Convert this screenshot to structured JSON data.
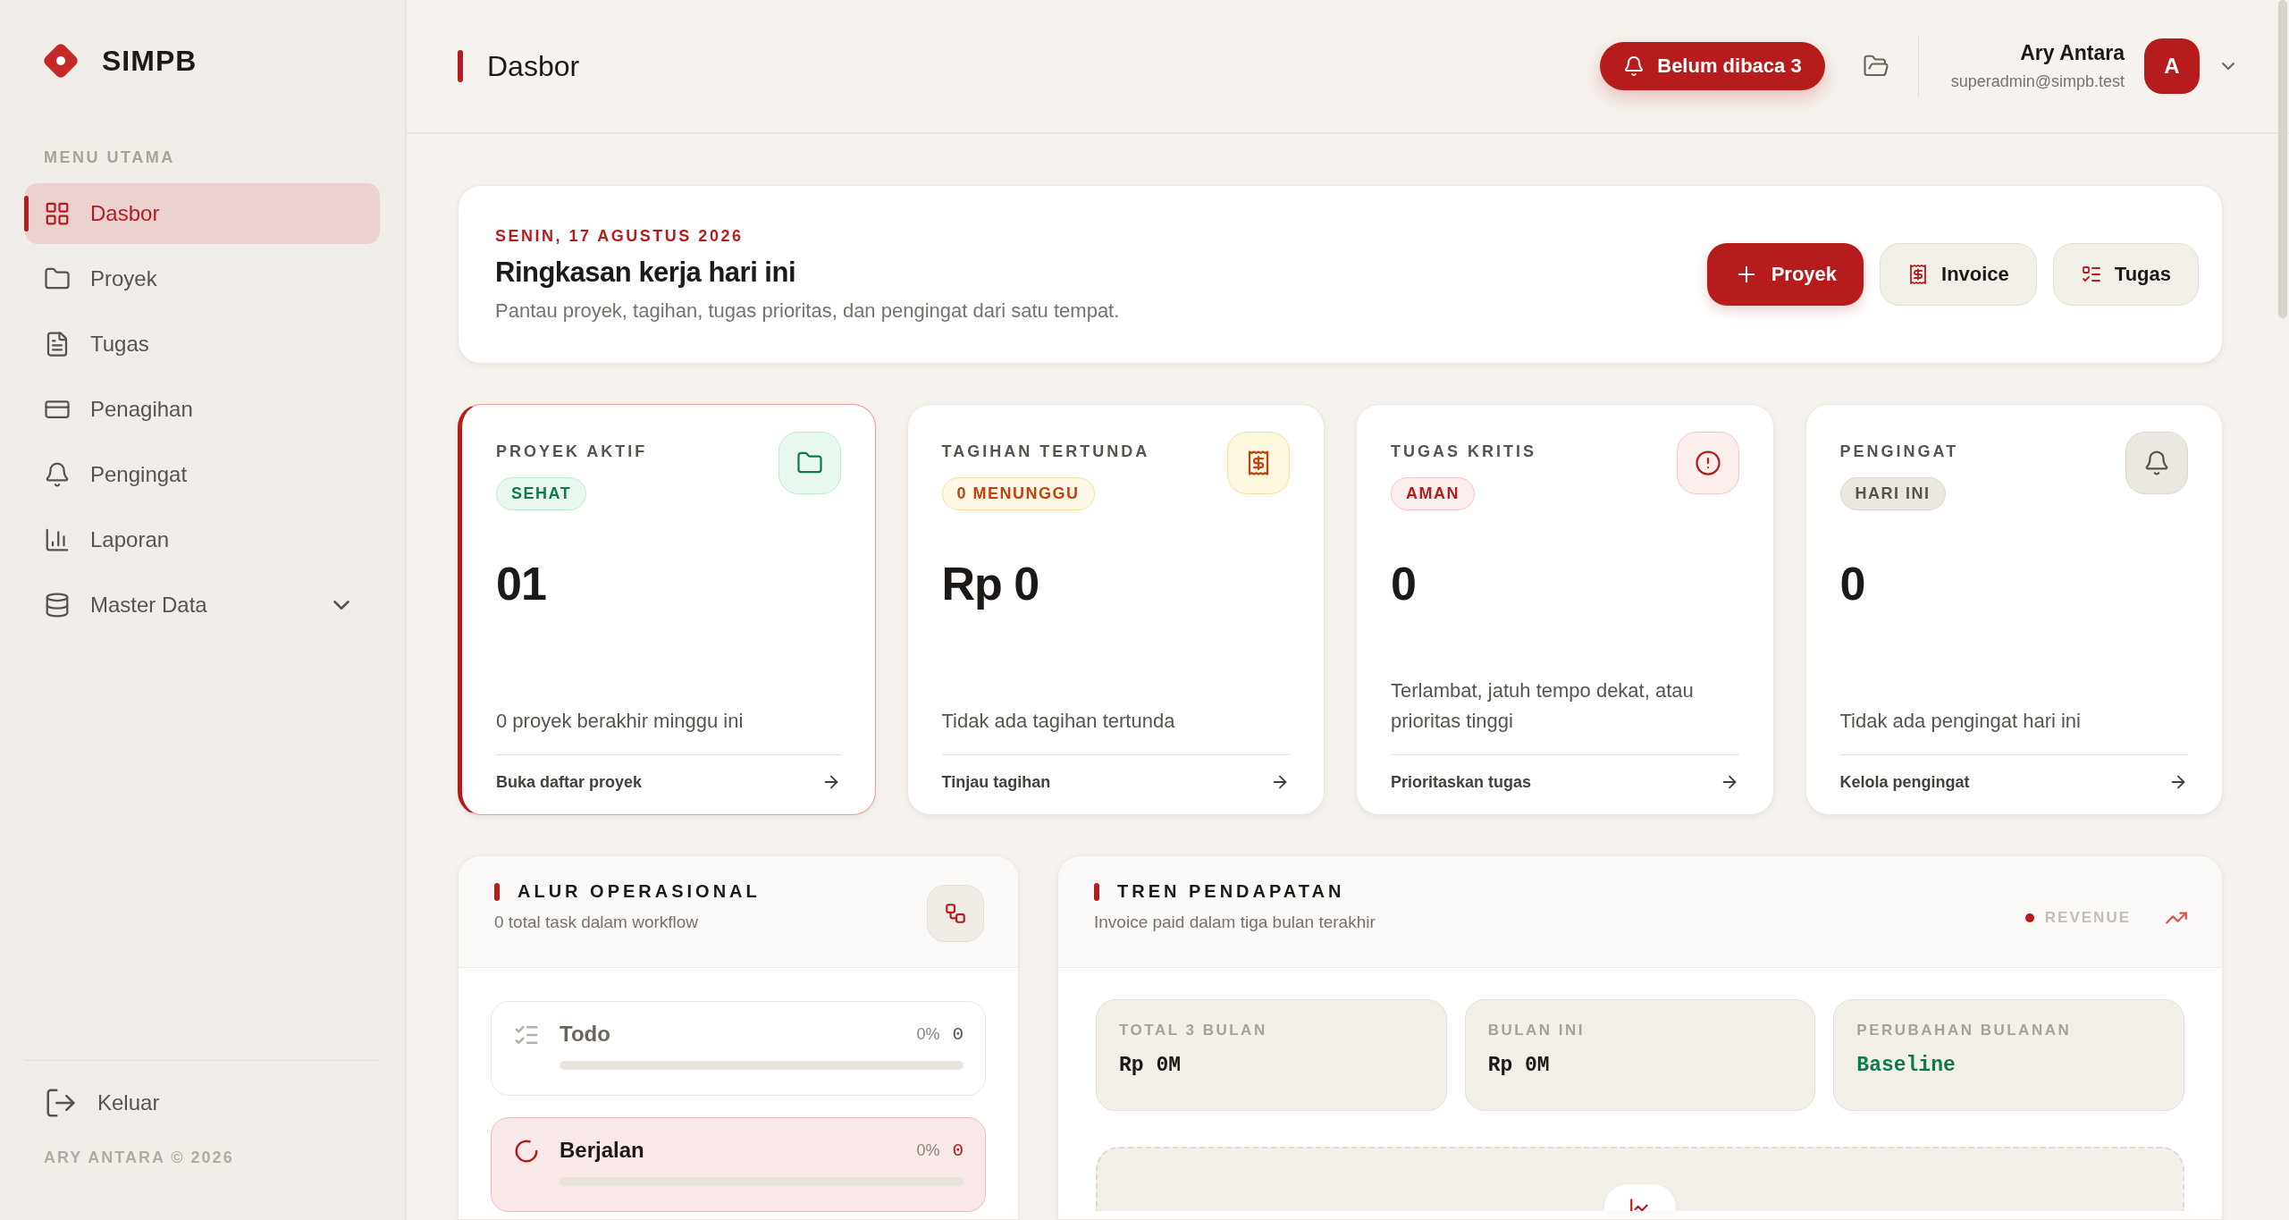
{
  "app": {
    "name": "SIMPB"
  },
  "sidebar": {
    "section": "MENU UTAMA",
    "items": [
      {
        "label": "Dasbor",
        "selected": true
      },
      {
        "label": "Proyek",
        "selected": false
      },
      {
        "label": "Tugas",
        "selected": false
      },
      {
        "label": "Penagihan",
        "selected": false
      },
      {
        "label": "Pengingat",
        "selected": false
      },
      {
        "label": "Laporan",
        "selected": false
      },
      {
        "label": "Master Data",
        "selected": false,
        "expanded": false
      }
    ],
    "logout": "Keluar",
    "footer": "ARY ANTARA © 2026"
  },
  "header": {
    "title": "Dasbor",
    "notification": "Belum dibaca 3",
    "user": {
      "name": "Ary Antara",
      "email": "superadmin@simpb.test",
      "initial": "A"
    }
  },
  "summary": {
    "date": "SENIN, 17 AGUSTUS 2026",
    "title": "Ringkasan kerja hari ini",
    "subtitle": "Pantau proyek, tagihan, tugas prioritas, dan pengingat dari satu tempat.",
    "actions": [
      {
        "label": "Proyek",
        "kind": "primary"
      },
      {
        "label": "Invoice",
        "kind": "secondary"
      },
      {
        "label": "Tugas",
        "kind": "secondary"
      }
    ]
  },
  "stats": [
    {
      "label": "PROYEK AKTIF",
      "badge": "SEHAT",
      "kind": "success",
      "value": "01",
      "description": "0 proyek berakhir minggu ini",
      "link": "Buka daftar proyek",
      "selected": true
    },
    {
      "label": "TAGIHAN TERTUNDA",
      "badge": "0 MENUNGGU",
      "kind": "warning",
      "value": "Rp 0",
      "description": "Tidak ada tagihan tertunda",
      "link": "Tinjau tagihan",
      "selected": false
    },
    {
      "label": "TUGAS KRITIS",
      "badge": "AMAN",
      "kind": "danger",
      "value": "0",
      "description": "Terlambat, jatuh tempo dekat, atau prioritas tinggi",
      "link": "Prioritaskan tugas",
      "selected": false
    },
    {
      "label": "PENGINGAT",
      "badge": "HARI INI",
      "kind": "neutral",
      "value": "0",
      "description": "Tidak ada pengingat hari ini",
      "link": "Kelola pengingat",
      "selected": false
    }
  ],
  "workflow": {
    "title": "ALUR OPERASIONAL",
    "subtitle": "0 total task dalam workflow",
    "stages": [
      {
        "label": "Todo",
        "kind": "todo",
        "percent": "0%",
        "count": "0",
        "level": 0,
        "selected": false
      },
      {
        "label": "Berjalan",
        "kind": "progress",
        "percent": "0%",
        "count": "0",
        "level": 0,
        "selected": true
      }
    ]
  },
  "revenue": {
    "title": "TREN PENDAPATAN",
    "subtitle": "Invoice paid dalam tiga bulan terakhir",
    "legend": "REVENUE",
    "metrics": [
      {
        "label": "TOTAL 3 BULAN",
        "value": "Rp 0M",
        "kind": "neutral"
      },
      {
        "label": "BULAN INI",
        "value": "Rp 0M",
        "kind": "neutral"
      },
      {
        "label": "PERUBAHAN BULANAN",
        "value": "Baseline",
        "kind": "positive"
      }
    ]
  }
}
